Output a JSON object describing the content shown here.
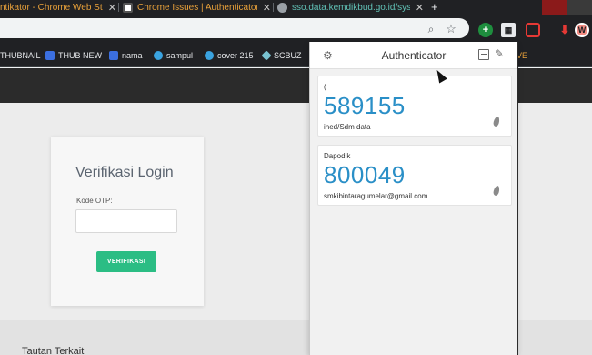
{
  "tabs": [
    {
      "label": "ntikator - Chrome Web Sto",
      "close": "✕"
    },
    {
      "label": "Chrome Issues | Authenticator",
      "close": "✕"
    },
    {
      "label": "sso.data.kemdikbud.go.id/sys/l",
      "close": "✕"
    }
  ],
  "new_tab": "+",
  "toolbar": {
    "zoom_icon": "⌕",
    "star_icon": "☆",
    "ext_qr_label": "▦",
    "ext_green_label": "+",
    "ext_download_icon": "⬇",
    "ext_avatar_label": "W"
  },
  "bookmarks": [
    {
      "label": "THUBNAIL",
      "icon": "bookmark-icon"
    },
    {
      "label": "THUB NEW",
      "icon": "shield-icon"
    },
    {
      "label": "nama",
      "icon": "shield-icon"
    },
    {
      "label": "sampul",
      "icon": "circle-icon"
    },
    {
      "label": "cover 215",
      "icon": "circle-icon"
    },
    {
      "label": "SCBUZ",
      "icon": "diamond-icon"
    },
    {
      "label": "VE",
      "icon": ""
    }
  ],
  "login": {
    "title": "Verifikasi Login",
    "otp_label": "Kode OTP:",
    "otp_value": "",
    "verify_button": "VERIFIKASI"
  },
  "footer": {
    "title": "Tautan Terkait"
  },
  "authenticator": {
    "title": "Authenticator",
    "gear_icon": "⚙",
    "edit_icon": "✎",
    "accounts": [
      {
        "issuer": "(",
        "code": "589155",
        "account": "ined/Sdm data"
      },
      {
        "issuer": "Dapodik",
        "code": "800049",
        "account": "smkibintaragumelar@gmail.com"
      }
    ]
  }
}
